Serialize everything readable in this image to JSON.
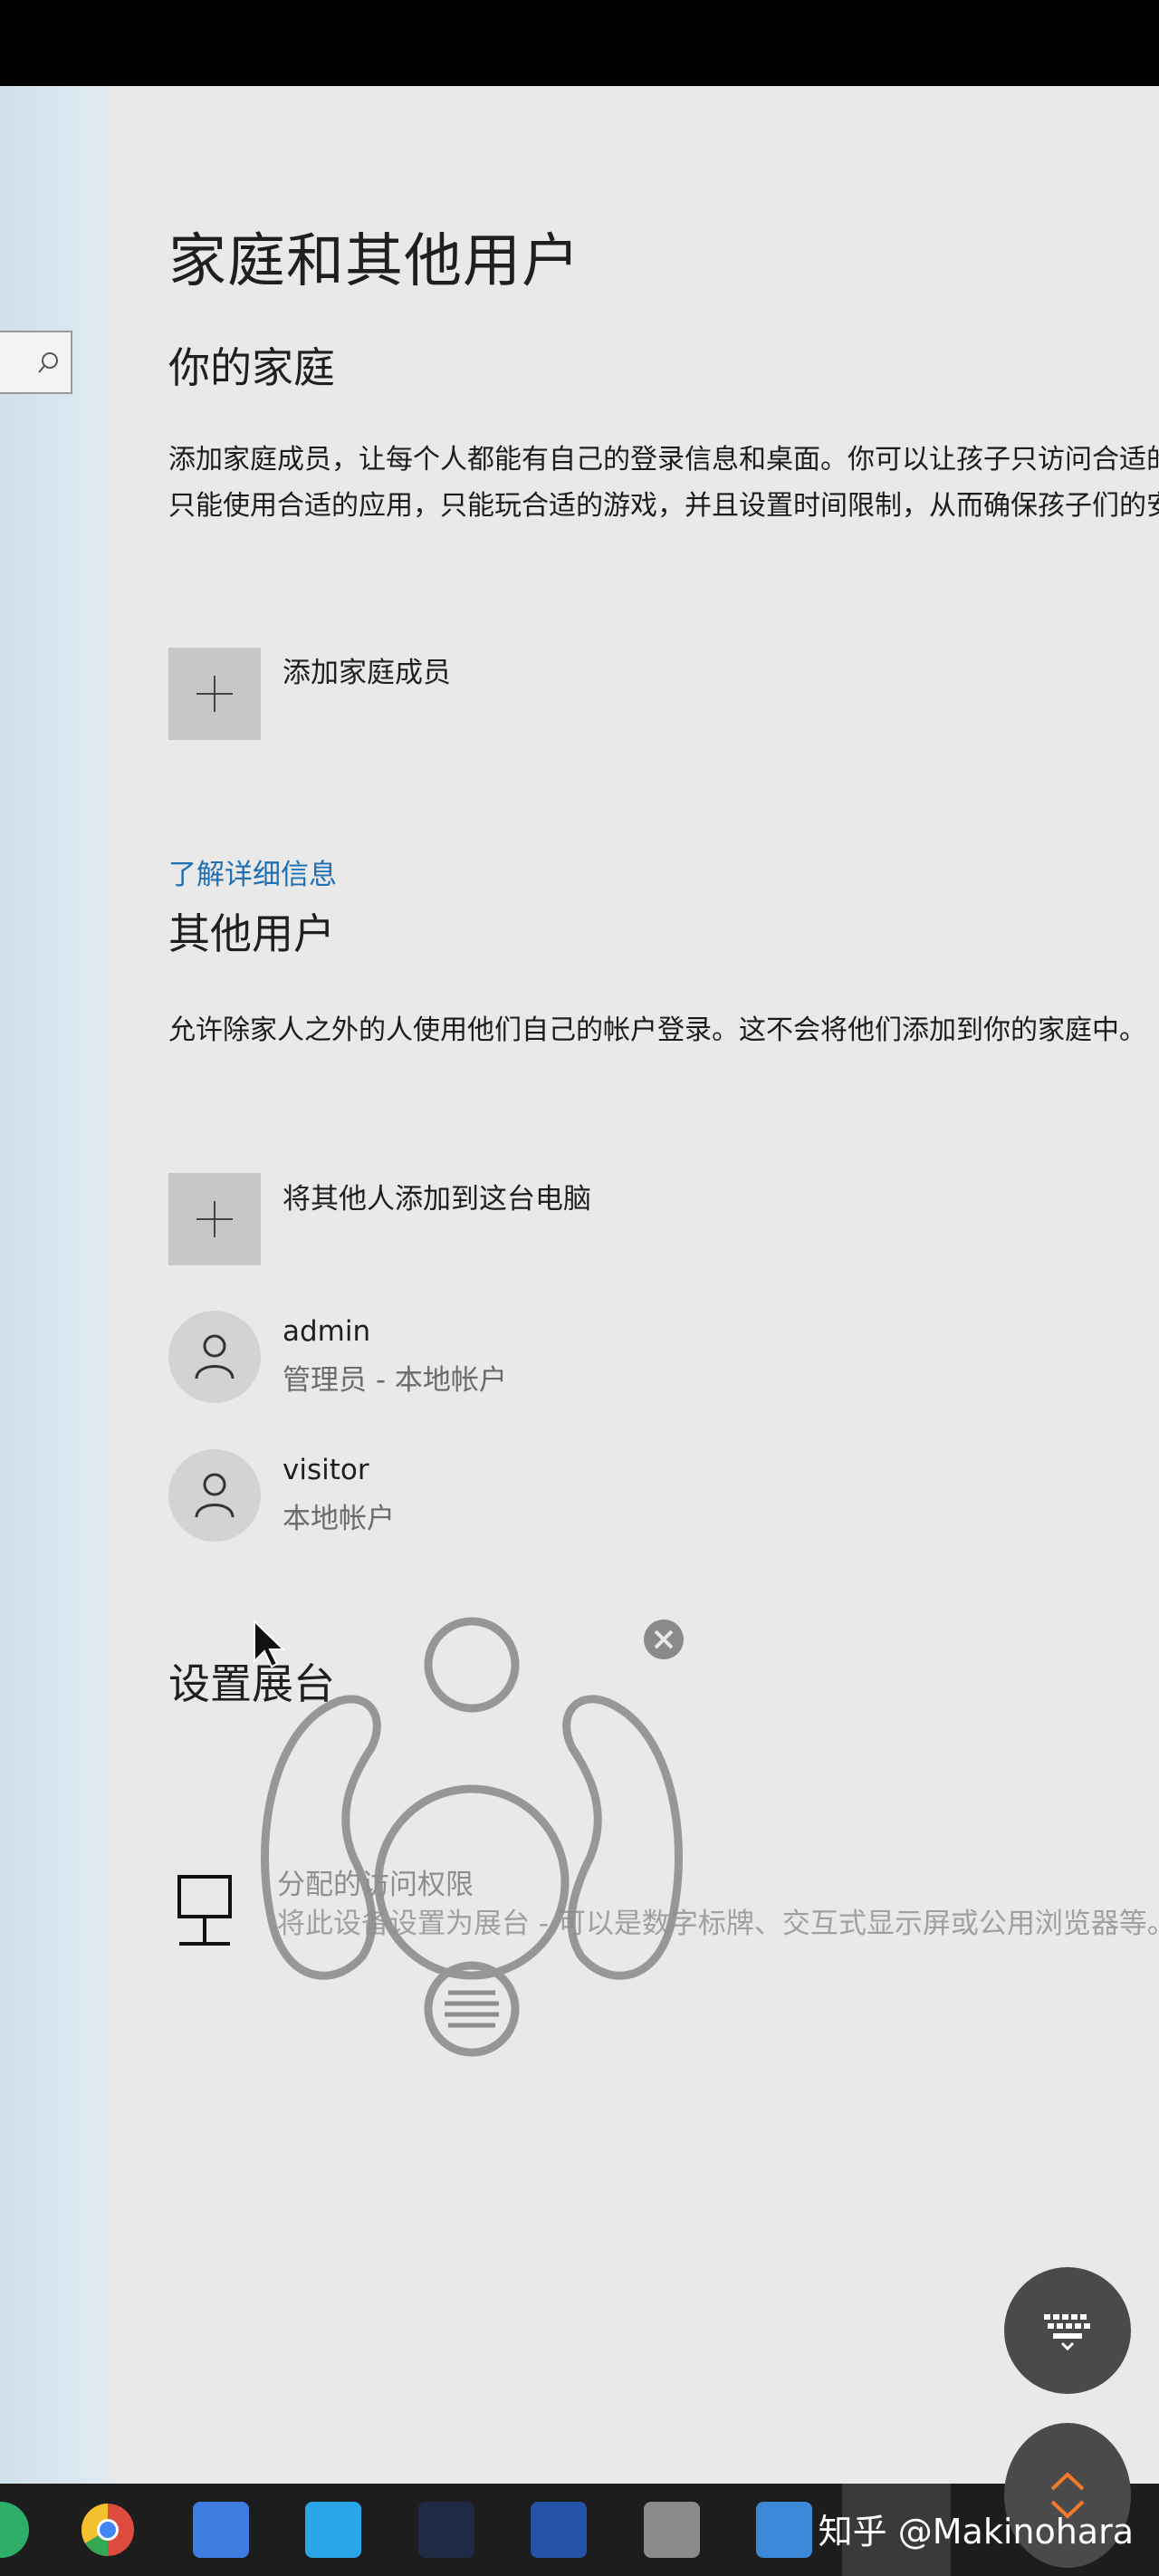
{
  "page_title": "家庭和其他用户",
  "family": {
    "heading": "你的家庭",
    "description": "添加家庭成员，让每个人都能有自己的登录信息和桌面。你可以让孩子只访问合适的网站，只能使用合适的应用，只能玩合适的游戏，并且设置时间限制，从而确保孩子们的安全。",
    "add_label": "添加家庭成员",
    "learn_more": "了解详细信息"
  },
  "others": {
    "heading": "其他用户",
    "description": "允许除家人之外的人使用他们自己的帐户登录。这不会将他们添加到你的家庭中。",
    "add_label": "将其他人添加到这台电脑",
    "users": [
      {
        "name": "admin",
        "sub": "管理员 - 本地帐户"
      },
      {
        "name": "visitor",
        "sub": "本地帐户"
      }
    ]
  },
  "kiosk": {
    "heading": "设置展台",
    "title": "分配的访问权限",
    "description": "将此设备设置为展台 - 可以是数字标牌、交互式显示屏或公用浏览器等。"
  },
  "watermark": "知乎 @Makinohara",
  "icons": {
    "search": "search-icon",
    "plus": "plus-icon",
    "person": "person-icon",
    "kiosk": "kiosk-icon",
    "keyboard": "keyboard-icon",
    "chevrons": "chevron-up-down-icon",
    "close": "close-icon"
  },
  "colors": {
    "link": "#1f6fb5",
    "background": "#e9e9e9",
    "fab": "#4a4a4a"
  }
}
